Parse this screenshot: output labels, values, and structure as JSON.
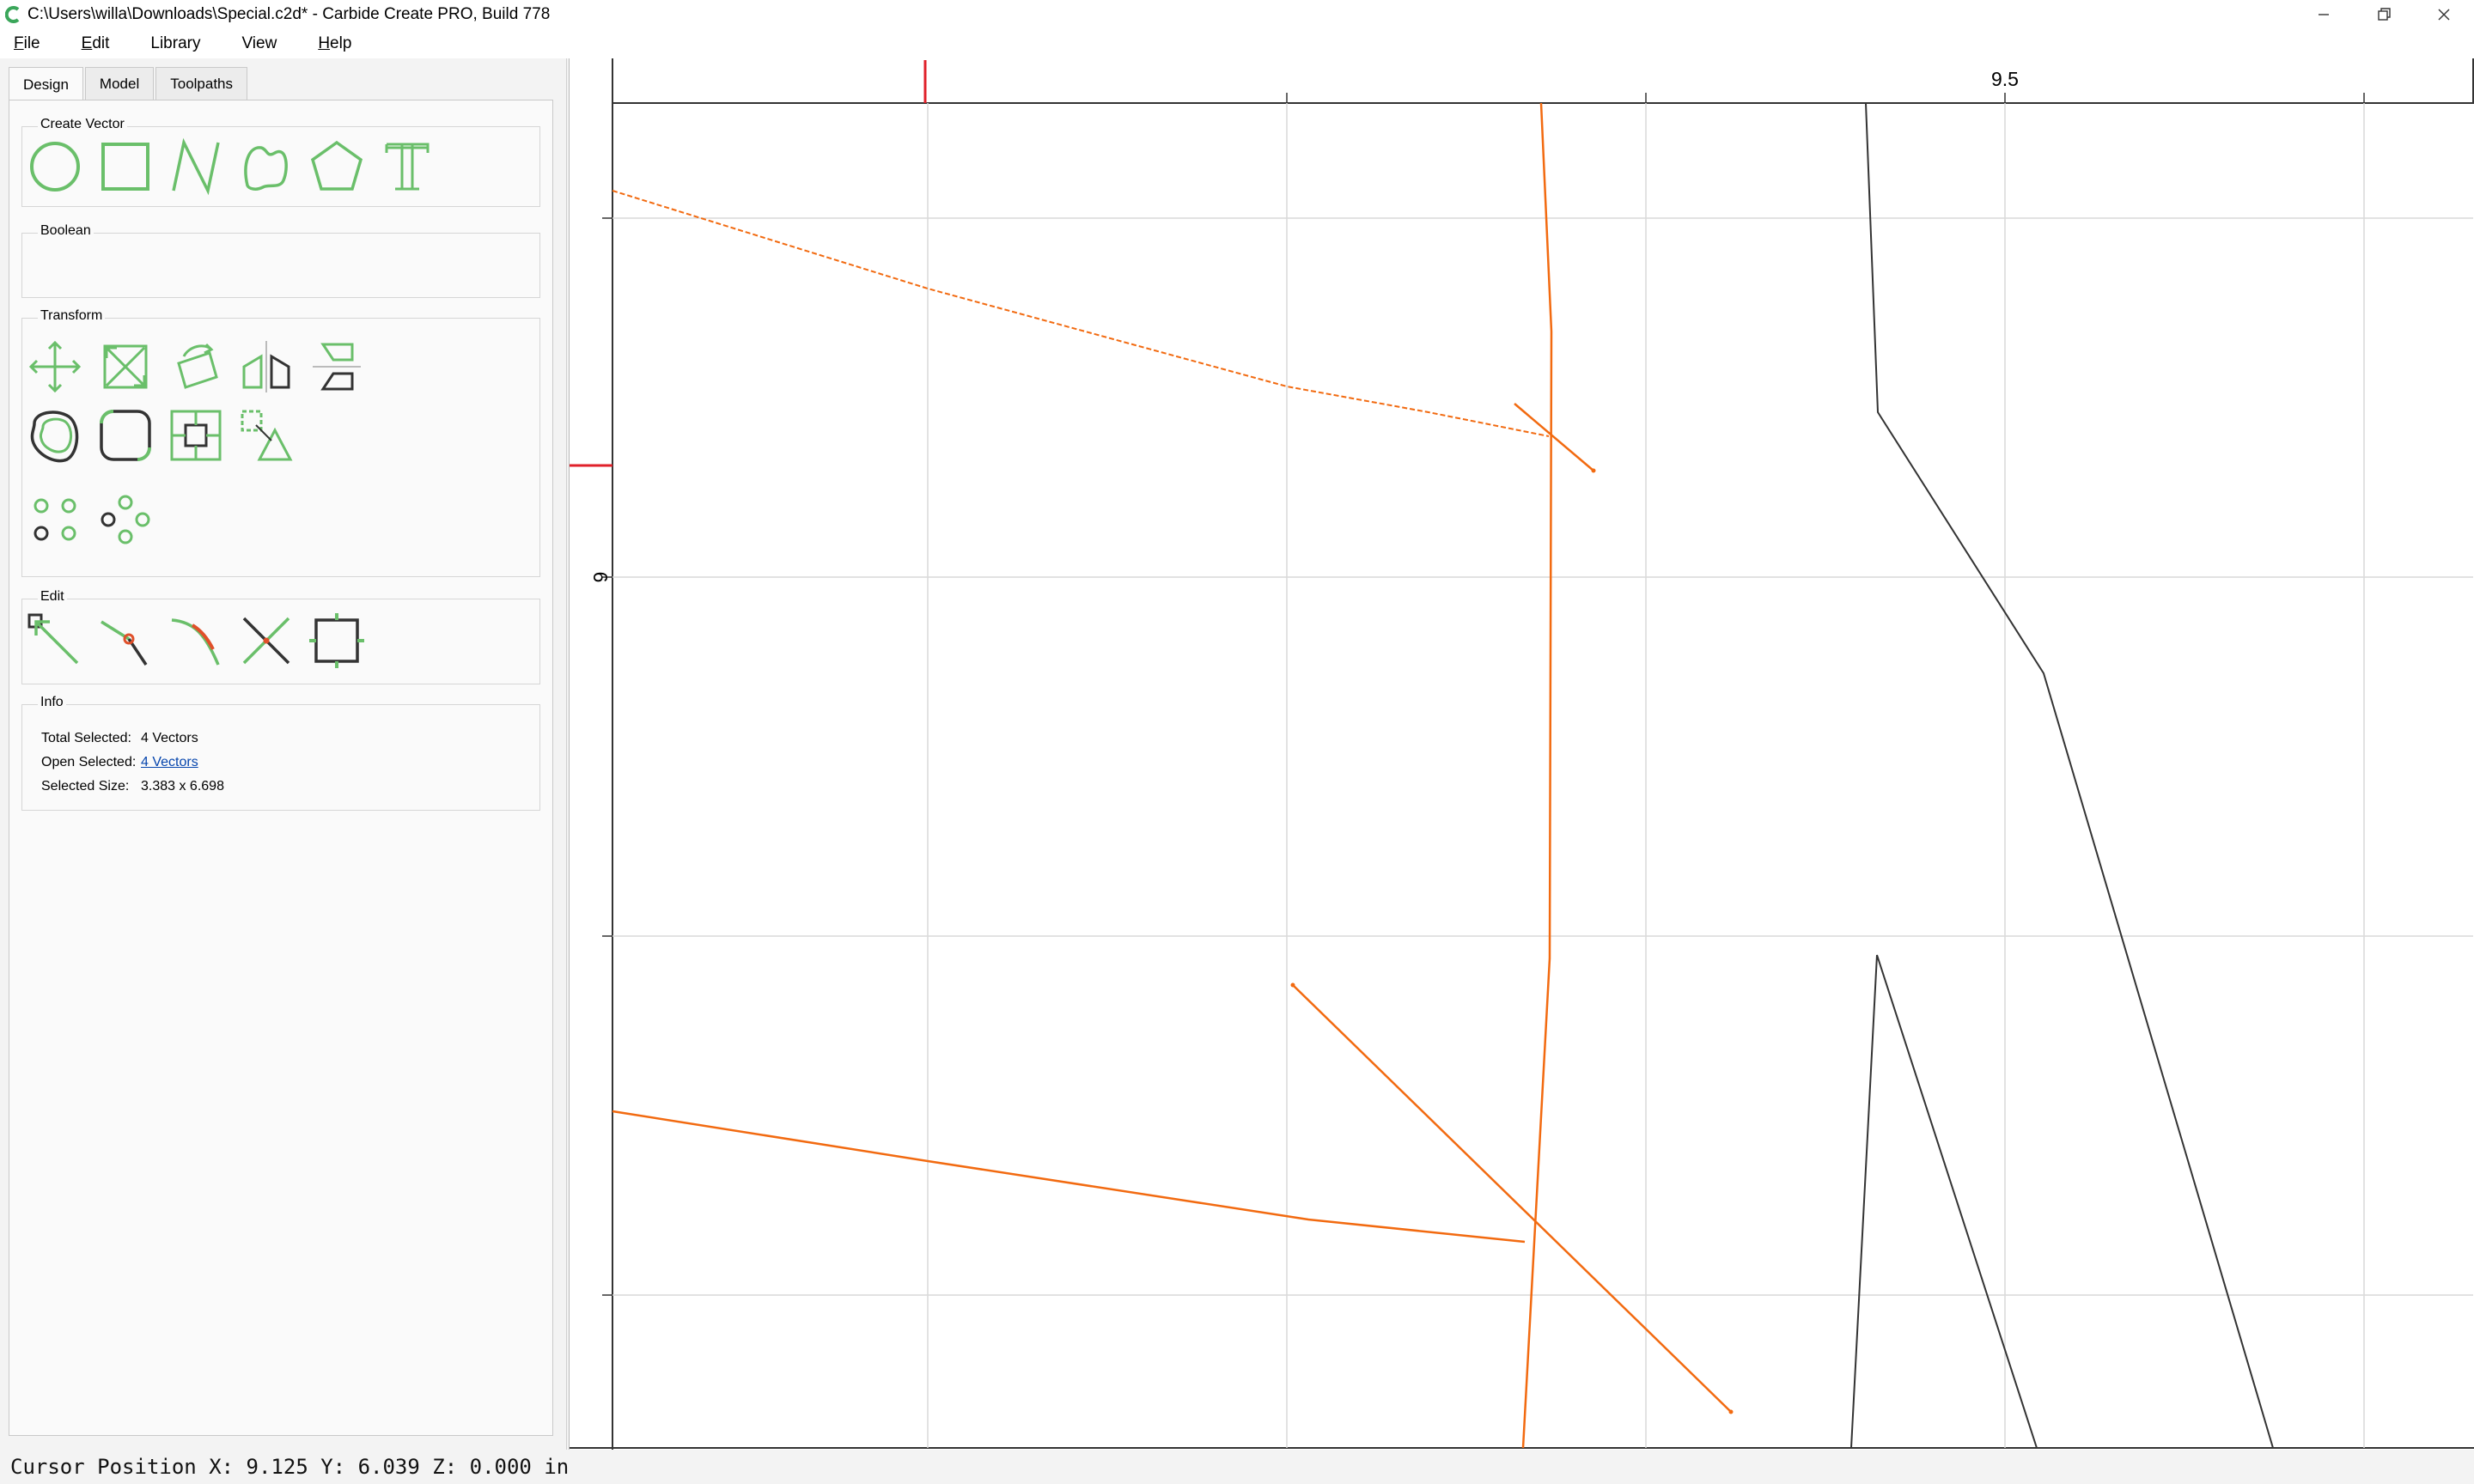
{
  "window": {
    "title": "C:\\Users\\willa\\Downloads\\Special.c2d* - Carbide Create PRO, Build 778"
  },
  "menu": {
    "items": [
      {
        "label": "File",
        "accel": "F",
        "rest": "ile"
      },
      {
        "label": "Edit",
        "accel": "E",
        "rest": "dit"
      },
      {
        "label": "Library",
        "accel": "",
        "rest": "Library"
      },
      {
        "label": "View",
        "accel": "",
        "rest": "View"
      },
      {
        "label": "Help",
        "accel": "H",
        "rest": "elp"
      }
    ]
  },
  "tabs": [
    "Design",
    "Model",
    "Toolpaths"
  ],
  "groups": {
    "create_vector": "Create Vector",
    "boolean": "Boolean",
    "transform": "Transform",
    "edit": "Edit",
    "info": "Info"
  },
  "info": {
    "total_selected_label": "Total Selected:",
    "total_selected_value": "4 Vectors",
    "open_selected_label": "Open Selected:",
    "open_selected_value": "4 Vectors",
    "selected_size_label": "Selected Size:",
    "selected_size_value": "3.383 x 6.698"
  },
  "ruler": {
    "top_label": "9.5",
    "left_label": "6"
  },
  "status": {
    "cursor": "Cursor Position X: 9.125 Y: 6.039 Z: 0.000 in"
  },
  "colors": {
    "tool_green": "#6abf6a",
    "vector_selected": "#f26a10",
    "vector_normal": "#333333",
    "grid": "#d9d9d9",
    "cursor_marker": "#e0202a"
  }
}
